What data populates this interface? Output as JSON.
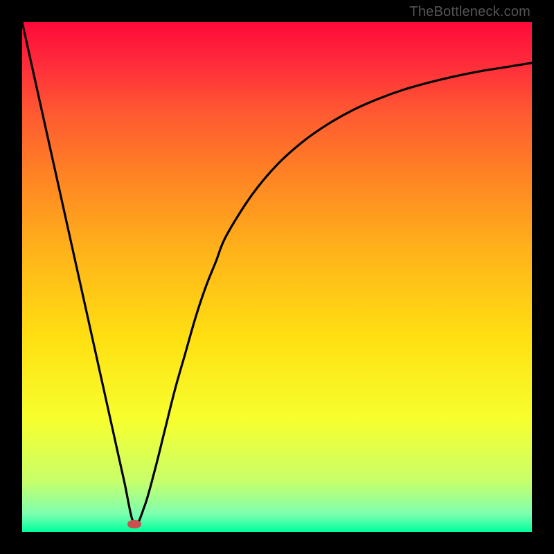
{
  "watermark": "TheBottleneck.com",
  "chart_data": {
    "type": "line",
    "title": "",
    "xlabel": "",
    "ylabel": "",
    "xlim": [
      0,
      100
    ],
    "ylim": [
      0,
      100
    ],
    "grid": false,
    "legend": false,
    "series": [
      {
        "name": "curve",
        "x": [
          0,
          2,
          4,
          6,
          8,
          10,
          12,
          14,
          16,
          18,
          20,
          22,
          24,
          26,
          28,
          30,
          32,
          34,
          36,
          38,
          40,
          45,
          50,
          55,
          60,
          65,
          70,
          75,
          80,
          85,
          90,
          95,
          100
        ],
        "y": [
          100,
          91,
          82,
          73,
          64,
          55,
          46,
          37,
          28,
          19,
          10,
          1.5,
          5,
          12,
          20,
          28,
          35,
          42,
          48,
          53,
          58,
          66,
          72,
          76.5,
          80,
          82.8,
          85,
          86.8,
          88.2,
          89.4,
          90.4,
          91.2,
          92
        ]
      }
    ],
    "marker": {
      "x": 22,
      "y": 1.5,
      "color": "#cc4f4f"
    },
    "gradient_stops": [
      {
        "offset": 0.0,
        "color": "#ff0a3a"
      },
      {
        "offset": 0.08,
        "color": "#ff2b3b"
      },
      {
        "offset": 0.18,
        "color": "#ff5a31"
      },
      {
        "offset": 0.3,
        "color": "#ff8324"
      },
      {
        "offset": 0.45,
        "color": "#ffb31a"
      },
      {
        "offset": 0.62,
        "color": "#ffe012"
      },
      {
        "offset": 0.78,
        "color": "#f7ff2e"
      },
      {
        "offset": 0.9,
        "color": "#c8ff6a"
      },
      {
        "offset": 0.965,
        "color": "#7dffb0"
      },
      {
        "offset": 1.0,
        "color": "#00ff9c"
      }
    ]
  }
}
